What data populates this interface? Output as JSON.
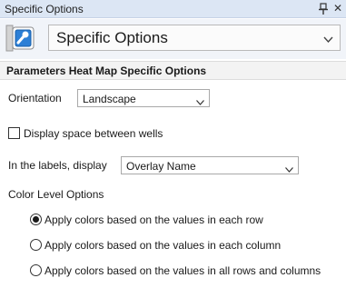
{
  "panel": {
    "title": "Specific Options",
    "pin_icon": "pin-icon",
    "close_icon": "close-icon"
  },
  "header": {
    "icon": "wrench-settings-icon",
    "selected_view": "Specific Options"
  },
  "section": {
    "title": "Parameters Heat Map Specific Options"
  },
  "orientation": {
    "label": "Orientation",
    "value": "Landscape"
  },
  "spacing": {
    "label": "Display space between wells",
    "checked": false
  },
  "labels_display": {
    "label": "In the labels, display",
    "value": "Overlay Name"
  },
  "color_level": {
    "title": "Color Level Options",
    "options": [
      {
        "label": "Apply colors based on the values in each row",
        "selected": true
      },
      {
        "label": "Apply colors based on the values in each column",
        "selected": false
      },
      {
        "label": "Apply colors based on the values in all rows and columns",
        "selected": false
      }
    ]
  },
  "colors": {
    "titlebar_bg": "#dce6f4",
    "header_bg": "#f1f4f9",
    "icon_blue": "#1f6fc6"
  }
}
